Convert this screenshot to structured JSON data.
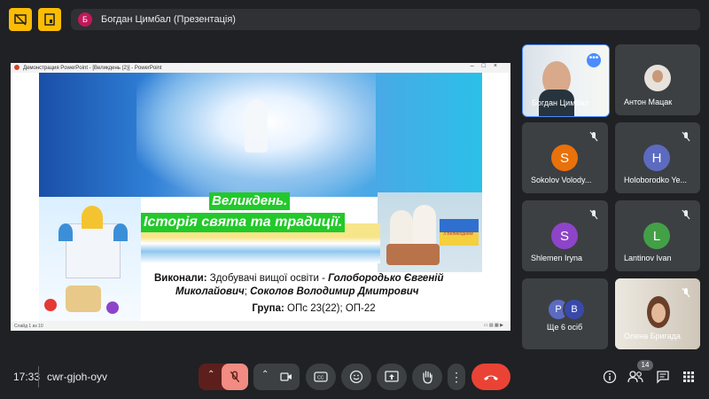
{
  "presenter": {
    "initial": "Б",
    "name": "Богдан Цимбал (Презентація)"
  },
  "presentation": {
    "window_title": "Демонстрация PowerPoint - [Великдень (2)] - PowerPoint",
    "status": "Слайд 1 из 10",
    "slide": {
      "title_line1": "Великдень.",
      "title_line2": "Історія свята та традиції.",
      "card_text": "З Великоднем!",
      "authors_label": "Виконали:",
      "authors_prefix": "Здобувачі вищої освіти -",
      "author1": "Голобородько Євгеній",
      "author1_cont": "Миколайович",
      "author2": "Соколов Володимир Дмитрович",
      "group_label": "Група:",
      "group_value": "ОПс 23(22); ОП-22"
    }
  },
  "participants": [
    {
      "name": "Богдан Цимбал",
      "type": "video"
    },
    {
      "name": "Антон Мацак",
      "type": "photo"
    },
    {
      "name": "Sokolov Volody...",
      "initial": "S",
      "color": "#e8710a",
      "muted": true
    },
    {
      "name": "Holoborodko Ye...",
      "initial": "H",
      "color": "#5c6bc0",
      "muted": true
    },
    {
      "name": "Shlemen Iryna",
      "initial": "S",
      "color": "#8e44c9",
      "muted": true
    },
    {
      "name": "Lantinov Ivan",
      "initial": "L",
      "color": "#43a047",
      "muted": true
    },
    {
      "name": "Ще 6 осіб",
      "initials": [
        "P",
        "B"
      ]
    },
    {
      "name": "Олена Бригада",
      "type": "video",
      "muted": true
    }
  ],
  "footer": {
    "time": "17:33",
    "meeting_code": "cwr-gjoh-oyv",
    "people_count": "14"
  },
  "colors": {
    "accent_yellow": "#fbbc04",
    "end_call": "#ea4335",
    "mic_off": "#f28b82"
  }
}
